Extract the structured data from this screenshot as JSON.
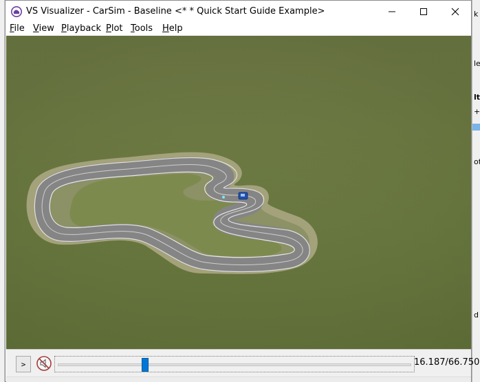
{
  "window": {
    "title": "VS Visualizer - CarSim - Baseline <* * Quick Start Guide Example>",
    "minimize_glyph": "—",
    "maximize_glyph": "☐",
    "close_glyph": "✕"
  },
  "menu": {
    "items": [
      {
        "first": "F",
        "rest": "ile"
      },
      {
        "first": "V",
        "rest": "iew"
      },
      {
        "first": "P",
        "rest": "layback"
      },
      {
        "first": "P",
        "rest": "lot"
      },
      {
        "first": "T",
        "rest": "ools"
      },
      {
        "first": "H",
        "rest": "elp"
      }
    ]
  },
  "background_window": {
    "fragments": [
      "k",
      "le",
      "lt",
      "+",
      "ot",
      "d"
    ]
  },
  "playback": {
    "play_label": ">",
    "time_readout": "16.187/66.750",
    "current_time": 16.187,
    "total_time": 66.75
  },
  "colors": {
    "slider_thumb": "#0078d7",
    "grass": "#6e7a44",
    "track": "#8a8a8a",
    "car": "#1e4fb0"
  }
}
